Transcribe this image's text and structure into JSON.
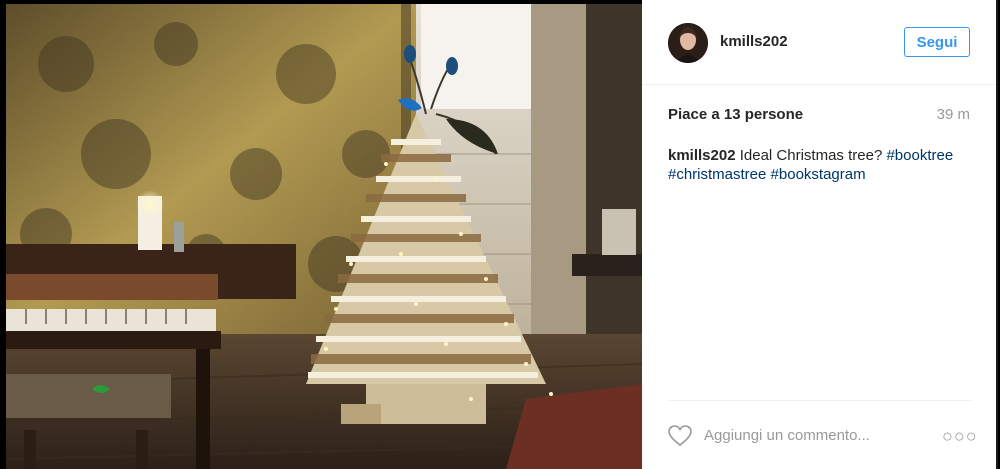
{
  "post": {
    "username": "kmills202",
    "follow_label": "Segui",
    "likes_text": "Piace a 13 persone",
    "time_ago": "39 m",
    "caption": {
      "username": "kmills202",
      "text": " Ideal Christmas tree? ",
      "hashtags": [
        "#booktree",
        "#christmastree",
        "#bookstagram"
      ]
    },
    "comment_placeholder": "Aggiungi un commento...",
    "more_label": "○○○"
  },
  "colors": {
    "accent": "#3897f0",
    "hashtag": "#003569",
    "muted": "#999999",
    "text": "#262626"
  },
  "icons": {
    "like": "heart-icon",
    "more": "more-options-icon"
  }
}
